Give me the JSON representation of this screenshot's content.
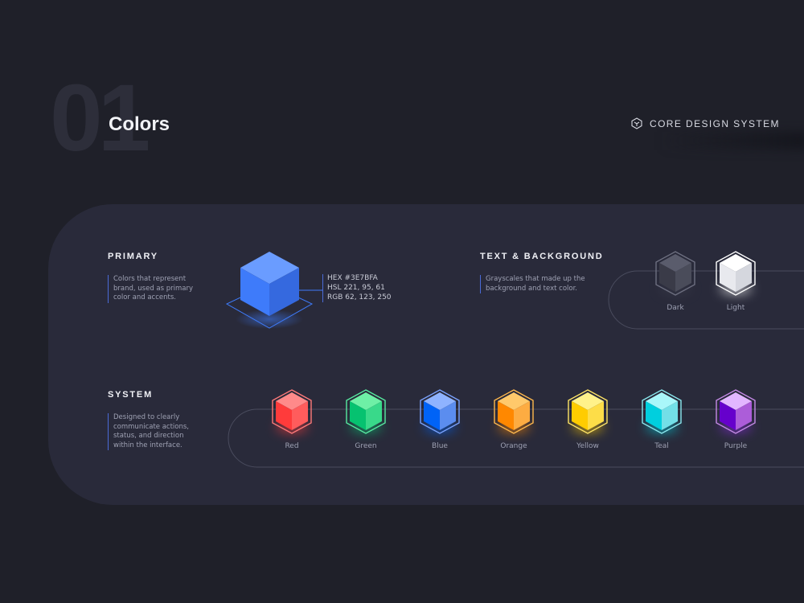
{
  "header": {
    "number": "01",
    "title": "Colors",
    "brand_label": "CORE DESIGN SYSTEM"
  },
  "primary": {
    "title": "PRIMARY",
    "description": [
      "Colors that represent",
      "brand, used as primary",
      "color and accents."
    ],
    "color": "#3E7BFA",
    "specs": [
      "HEX #3E7BFA",
      "HSL 221, 95, 61",
      "RGB 62, 123, 250"
    ]
  },
  "text_background": {
    "title": "TEXT & BACKGROUND",
    "description": [
      "Grayscales that made up the",
      "background and text color."
    ],
    "swatches": [
      {
        "label": "Dark",
        "top": "#5a5c6c",
        "left": "#3a3b48",
        "right": "#4a4c5a",
        "stroke": "#6d6f80",
        "glow": "#3a3b4a"
      },
      {
        "label": "Light",
        "top": "#ffffff",
        "left": "#e8e9ee",
        "right": "#d5d7de",
        "stroke": "#ffffff",
        "glow": "#ffffff"
      }
    ]
  },
  "system": {
    "title": "SYSTEM",
    "description": [
      "Designed to clearly",
      "communicate actions,",
      "status, and direction",
      "within the interface."
    ],
    "swatches": [
      {
        "label": "Red",
        "top": "#ff8a8a",
        "left": "#ff3b3b",
        "right": "#ff5c5c",
        "stroke": "#ff7a7a",
        "glow": "#ff3b3b"
      },
      {
        "label": "Green",
        "top": "#6ef0a6",
        "left": "#06c270",
        "right": "#39d98a",
        "stroke": "#57eba1",
        "glow": "#06c270"
      },
      {
        "label": "Blue",
        "top": "#8fb3ff",
        "left": "#0063f7",
        "right": "#5b8def",
        "stroke": "#7aa3ff",
        "glow": "#0063f7"
      },
      {
        "label": "Orange",
        "top": "#ffc96b",
        "left": "#ff8800",
        "right": "#fdac42",
        "stroke": "#ffb84d",
        "glow": "#ff8800"
      },
      {
        "label": "Yellow",
        "top": "#fff28a",
        "left": "#ffcc00",
        "right": "#fddd48",
        "stroke": "#ffe566",
        "glow": "#ffcc00"
      },
      {
        "label": "Teal",
        "top": "#a9f7fa",
        "left": "#00cfde",
        "right": "#73dfe7",
        "stroke": "#8be9ef",
        "glow": "#00cfde"
      },
      {
        "label": "Purple",
        "top": "#e2b6ff",
        "left": "#6600cc",
        "right": "#ac5dd9",
        "stroke": "#c58ae6",
        "glow": "#8a2be2"
      }
    ]
  }
}
